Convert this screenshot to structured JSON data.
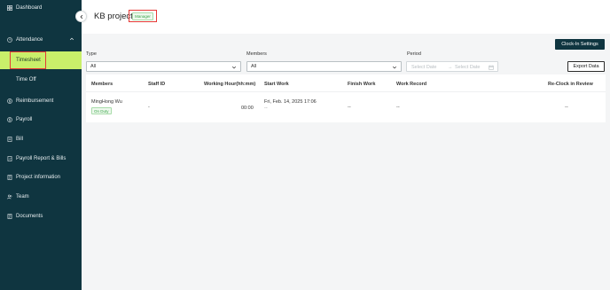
{
  "sidebar": {
    "items": [
      {
        "label": "Dashboard",
        "icon": "grid-icon"
      },
      {
        "label": "Attendance",
        "icon": "clock-icon"
      },
      {
        "label": "Timesheet"
      },
      {
        "label": "Time Off"
      },
      {
        "label": "Reimbursement",
        "icon": "dollar-circle-icon"
      },
      {
        "label": "Payroll",
        "icon": "dollar-circle-icon"
      },
      {
        "label": "Bill",
        "icon": "receipt-icon"
      },
      {
        "label": "Payroll Report & Bills",
        "icon": "report-icon"
      },
      {
        "label": "Project information",
        "icon": "document-icon"
      },
      {
        "label": "Team",
        "icon": "people-icon"
      },
      {
        "label": "Documents",
        "icon": "document-icon"
      }
    ]
  },
  "header": {
    "title": "KB project",
    "role_badge": "Manager"
  },
  "toolbar": {
    "clockin_label": "Clock-In Settings",
    "export_label": "Export Data"
  },
  "filters": {
    "type_label": "Type",
    "type_value": "All",
    "members_label": "Members",
    "members_value": "All",
    "period_label": "Period",
    "start_placeholder": "Select Date",
    "arrow": "→",
    "end_placeholder": "Select Date"
  },
  "table": {
    "headers": [
      "Members",
      "Staff ID",
      "Working Hour(hh:mm)",
      "Start Work",
      "Finish Work",
      "Work Record",
      "Re-Clock in Review"
    ],
    "rows": [
      {
        "member": "MingHong Wu",
        "status": "On Duty",
        "staff_id": "-",
        "working_hour": "00:00",
        "start_work": "Fri, Feb. 14, 2025 17:06",
        "start_sub": "--",
        "finish_work": "--",
        "work_record": "--",
        "reclock": "--"
      }
    ]
  },
  "colors": {
    "sidebar_bg": "#0f3540",
    "active_bg": "#c9ef6a",
    "highlight_border": "#e53935",
    "badge_green": "#3aa54a"
  }
}
